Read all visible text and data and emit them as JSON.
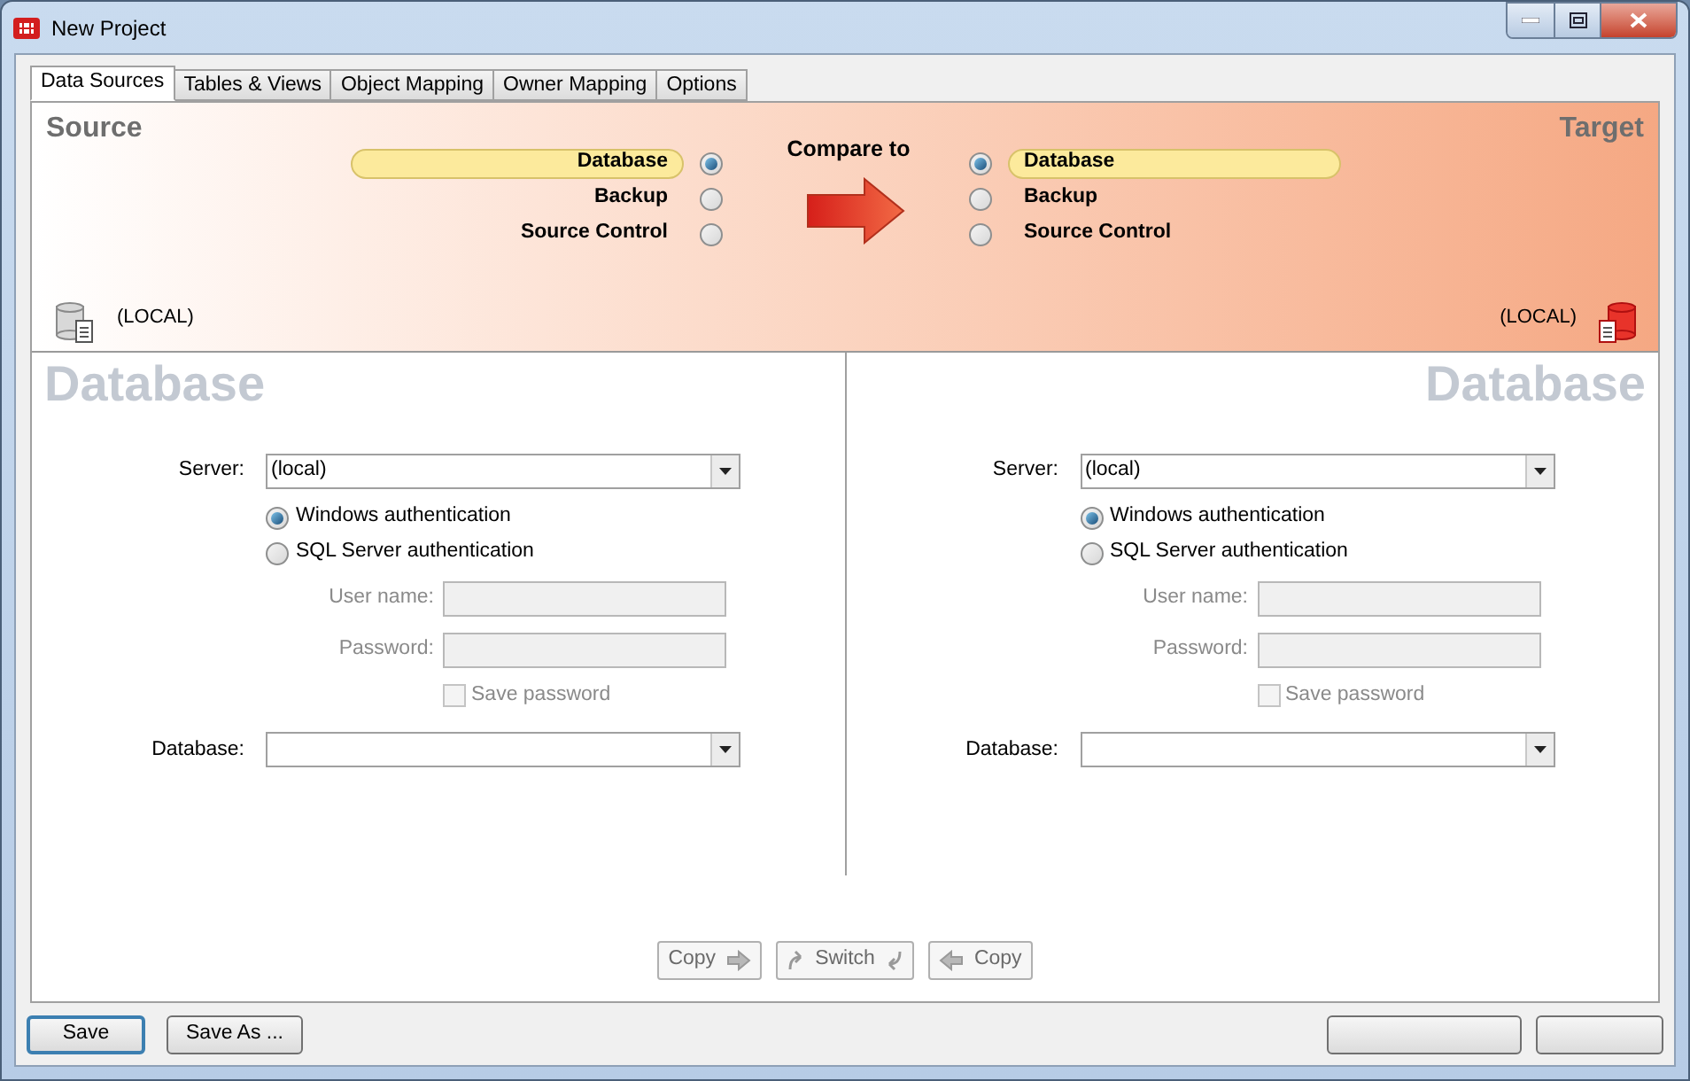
{
  "window": {
    "title": "New Project"
  },
  "tabs": [
    {
      "label": "Data Sources",
      "selected": true
    },
    {
      "label": "Tables & Views",
      "selected": false
    },
    {
      "label": "Object Mapping",
      "selected": false
    },
    {
      "label": "Owner Mapping",
      "selected": false
    },
    {
      "label": "Options",
      "selected": false
    }
  ],
  "source": {
    "heading": "Source",
    "options": [
      {
        "label": "Database",
        "selected": true
      },
      {
        "label": "Backup",
        "selected": false
      },
      {
        "label": "Source Control",
        "selected": false
      }
    ],
    "server": "(LOCAL)"
  },
  "compare_label": "Compare to",
  "target": {
    "heading": "Target",
    "options": [
      {
        "label": "Database",
        "selected": true
      },
      {
        "label": "Backup",
        "selected": false
      },
      {
        "label": "Source Control",
        "selected": false
      }
    ],
    "server": "(LOCAL)"
  },
  "panes": [
    {
      "title": "Database",
      "server_label": "Server:",
      "server": "(local)",
      "auth": [
        {
          "label": "Windows authentication",
          "selected": true
        },
        {
          "label": "SQL Server authentication",
          "selected": false
        }
      ],
      "user_label": "User name:",
      "password_label": "Password:",
      "save_password": {
        "label": "Save password",
        "checked": false
      },
      "database_label": "Database:"
    },
    {
      "title": "Database",
      "server_label": "Server:",
      "server": "(local)",
      "auth": [
        {
          "label": "Windows authentication",
          "selected": true
        },
        {
          "label": "SQL Server authentication",
          "selected": false
        }
      ],
      "user_label": "User name:",
      "password_label": "Password:",
      "save_password": {
        "label": "Save password",
        "checked": false
      },
      "database_label": "Database:"
    }
  ],
  "transfer_buttons": [
    {
      "label": "Copy",
      "kind": "right"
    },
    {
      "label": "Switch",
      "kind": "switch"
    },
    {
      "label": "Copy",
      "kind": "left"
    }
  ],
  "footer_buttons": [
    {
      "label": "Save",
      "default": true
    },
    {
      "label": "Save As ...",
      "default": false
    }
  ]
}
